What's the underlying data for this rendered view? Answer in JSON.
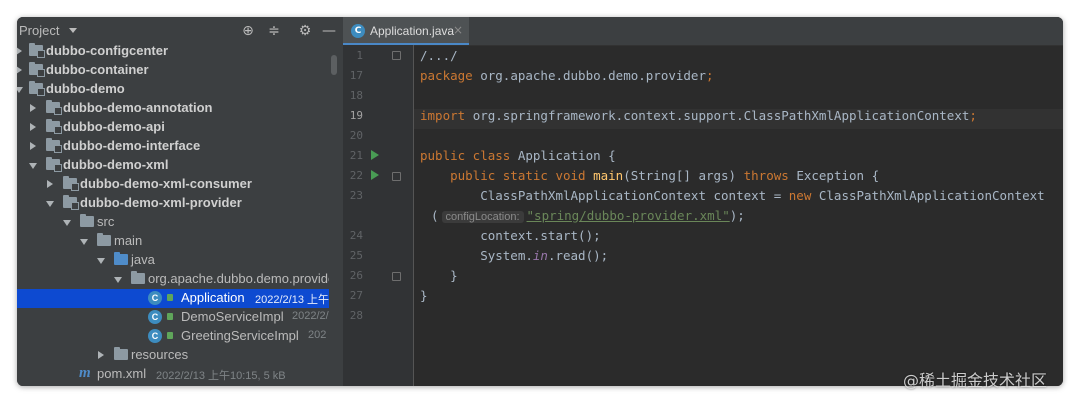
{
  "project": {
    "title": "Project",
    "header_icons": [
      "target-icon",
      "collapse-icon",
      "gear-icon",
      "minimize-icon"
    ],
    "tree": [
      {
        "label": "dubbo-configcenter",
        "type": "module",
        "expanded": false,
        "bold": true
      },
      {
        "label": "dubbo-container",
        "type": "module",
        "expanded": false,
        "bold": true
      },
      {
        "label": "dubbo-demo",
        "type": "module",
        "expanded": true,
        "bold": true
      },
      {
        "label": "dubbo-demo-annotation",
        "type": "module",
        "expanded": false,
        "bold": true
      },
      {
        "label": "dubbo-demo-api",
        "type": "module",
        "expanded": false,
        "bold": true
      },
      {
        "label": "dubbo-demo-interface",
        "type": "module",
        "expanded": false,
        "bold": true
      },
      {
        "label": "dubbo-demo-xml",
        "type": "module",
        "expanded": true,
        "bold": true
      },
      {
        "label": "dubbo-demo-xml-consumer",
        "type": "module",
        "expanded": false,
        "bold": true
      },
      {
        "label": "dubbo-demo-xml-provider",
        "type": "module",
        "expanded": true,
        "bold": true
      },
      {
        "label": "src",
        "type": "folder",
        "expanded": true
      },
      {
        "label": "main",
        "type": "folder",
        "expanded": true
      },
      {
        "label": "java",
        "type": "source-folder",
        "expanded": true
      },
      {
        "label": "org.apache.dubbo.demo.provider",
        "type": "package",
        "expanded": true
      },
      {
        "label": "Application",
        "type": "class",
        "meta": "2022/2/13 上午",
        "selected": true
      },
      {
        "label": "DemoServiceImpl",
        "type": "class",
        "meta": "2022/2/"
      },
      {
        "label": "GreetingServiceImpl",
        "type": "class",
        "meta": "202"
      },
      {
        "label": "resources",
        "type": "folder",
        "expanded": false
      },
      {
        "label": "pom.xml",
        "type": "maven",
        "meta": "2022/2/13 上午10:15, 5 kB"
      }
    ]
  },
  "editor": {
    "tab": {
      "label": "Application.java",
      "close": "×"
    },
    "current_line": "19",
    "lines": [
      {
        "num": "1",
        "html": "/.../"
      },
      {
        "num": "17",
        "parts": [
          {
            "t": "package ",
            "c": "kw"
          },
          {
            "t": "org.apache.dubbo.demo.provider"
          },
          {
            "t": ";",
            "c": "kw"
          }
        ]
      },
      {
        "num": "18",
        "parts": []
      },
      {
        "num": "19",
        "parts": [
          {
            "t": "import ",
            "c": "kw"
          },
          {
            "t": "org.springframework.context.support.ClassPathXmlApplicationContext"
          },
          {
            "t": ";",
            "c": "kw"
          }
        ]
      },
      {
        "num": "20",
        "parts": []
      },
      {
        "num": "21",
        "parts": [
          {
            "t": "public class ",
            "c": "kw"
          },
          {
            "t": "Application {"
          }
        ]
      },
      {
        "num": "22",
        "parts": [
          {
            "t": "    public static void ",
            "c": "kw"
          },
          {
            "t": "main",
            "c": "fn"
          },
          {
            "t": "(String[] args) "
          },
          {
            "t": "throws ",
            "c": "kw"
          },
          {
            "t": "Exception {"
          }
        ]
      },
      {
        "num": "23",
        "parts": [
          {
            "t": "        ClassPathXmlApplicationContext context = "
          },
          {
            "t": "new ",
            "c": "kw"
          },
          {
            "t": "ClassPathXmlApplicationContext"
          }
        ]
      },
      {
        "num": "",
        "parts": [
          {
            "t": "("
          },
          {
            "t": "configLocation:",
            "c": "hint"
          },
          {
            "t": "\"spring/dubbo-provider.xml\"",
            "c": "str"
          },
          {
            "t": ");"
          }
        ]
      },
      {
        "num": "24",
        "parts": [
          {
            "t": "        context.start();"
          }
        ]
      },
      {
        "num": "25",
        "parts": [
          {
            "t": "        System."
          },
          {
            "t": "in",
            "c": "it"
          },
          {
            "t": ".read();"
          }
        ]
      },
      {
        "num": "26",
        "parts": [
          {
            "t": "    }"
          }
        ]
      },
      {
        "num": "27",
        "parts": [
          {
            "t": "}"
          }
        ]
      },
      {
        "num": "28",
        "parts": []
      }
    ]
  },
  "watermark": "@稀土掘金技术社区"
}
